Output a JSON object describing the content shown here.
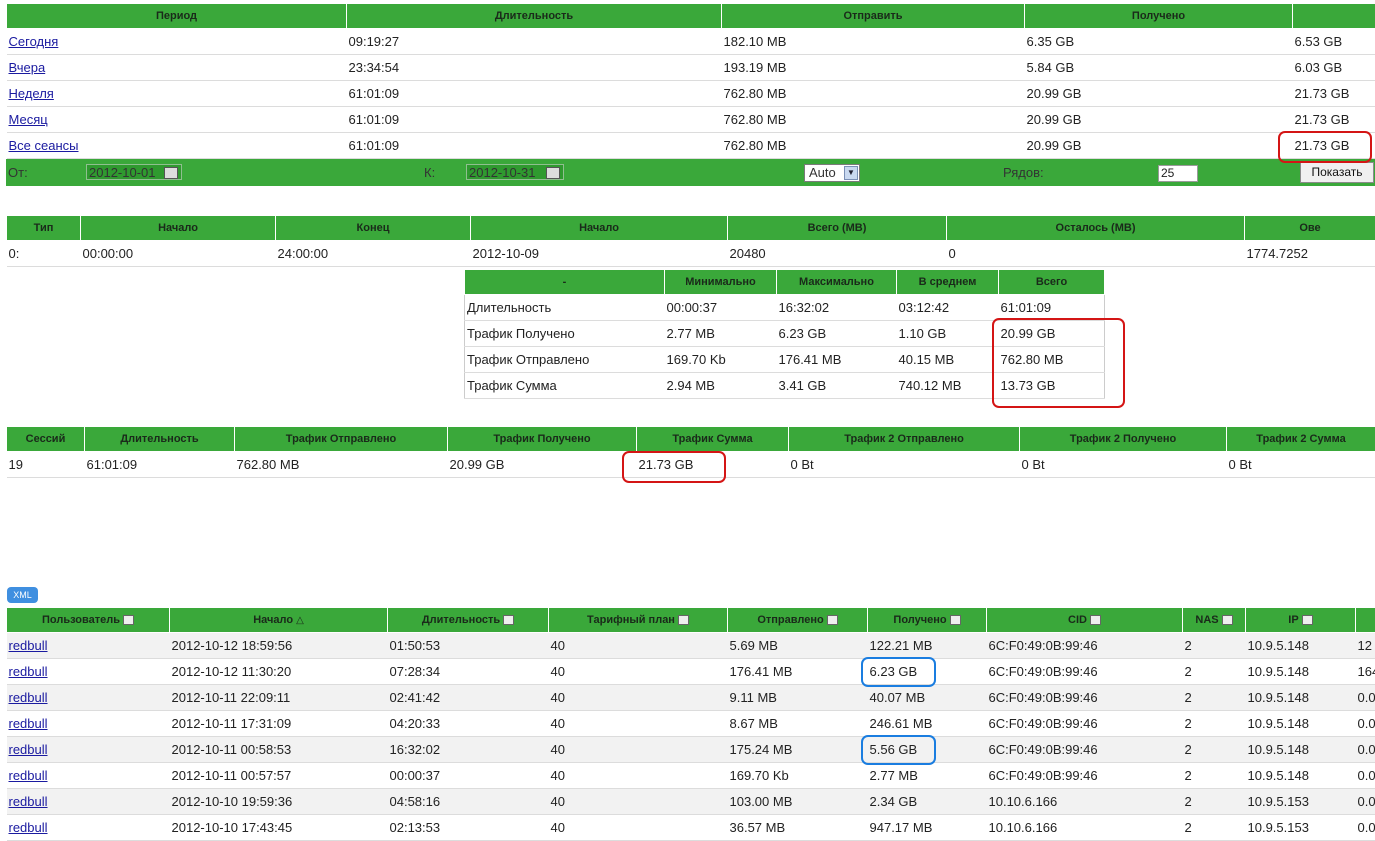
{
  "period_table": {
    "headers": [
      "Период",
      "Длительность",
      "Отправить",
      "Получено",
      ""
    ],
    "rows": [
      [
        "Сегодня",
        "09:19:27",
        "182.10 MB",
        "6.35 GB",
        "6.53 GB"
      ],
      [
        "Вчера",
        "23:34:54",
        "193.19 MB",
        "5.84 GB",
        "6.03 GB"
      ],
      [
        "Неделя",
        "61:01:09",
        "762.80 MB",
        "20.99 GB",
        "21.73 GB"
      ],
      [
        "Месяц",
        "61:01:09",
        "762.80 MB",
        "20.99 GB",
        "21.73 GB"
      ],
      [
        "Все сеансы",
        "61:01:09",
        "762.80 MB",
        "20.99 GB",
        "21.73 GB"
      ]
    ]
  },
  "filter": {
    "from_label": "От:",
    "from_value": "2012-10-01",
    "to_label": "К:",
    "to_value": "2012-10-31",
    "mode_value": "Auto",
    "rows_label": "Рядов:",
    "rows_value": "25",
    "show_button": "Показать"
  },
  "tariff_table": {
    "headers": [
      "Тип",
      "Начало",
      "Конец",
      "Начало",
      "Всего (MB)",
      "Осталось (MB)",
      "Ове"
    ],
    "row": [
      "0:",
      "00:00:00",
      "24:00:00",
      "2012-10-09",
      "20480",
      "0",
      "1774.7252"
    ]
  },
  "stats_table": {
    "headers": [
      "-",
      "Минимально",
      "Максимально",
      "В среднем",
      "Всего"
    ],
    "rows": [
      [
        "Длительность",
        "00:00:37",
        "16:32:02",
        "03:12:42",
        "61:01:09"
      ],
      [
        "Трафик Получено",
        "2.77 MB",
        "6.23 GB",
        "1.10 GB",
        "20.99 GB"
      ],
      [
        "Трафик Отправлено",
        "169.70 Kb",
        "176.41 MB",
        "40.15 MB",
        "762.80 MB"
      ],
      [
        "Трафик Сумма",
        "2.94 MB",
        "3.41 GB",
        "740.12 MB",
        "13.73 GB"
      ]
    ]
  },
  "totals_table": {
    "headers": [
      "Сессий",
      "Длительность",
      "Трафик Отправлено",
      "Трафик Получено",
      "Трафик Сумма",
      "Трафик 2 Отправлено",
      "Трафик 2 Получено",
      "Трафик 2 Сумма"
    ],
    "row": [
      "19",
      "61:01:09",
      "762.80 MB",
      "20.99 GB",
      "21.73 GB",
      "0 Bt",
      "0 Bt",
      "0 Bt"
    ]
  },
  "xml_button": "XML",
  "sessions_table": {
    "headers": [
      "Пользователь",
      "Начало",
      "Длительность",
      "Тарифный план",
      "Отправлено",
      "Получено",
      "CID",
      "NAS",
      "IP",
      ""
    ],
    "rows": [
      [
        "redbull",
        "2012-10-12 18:59:56",
        "01:50:53",
        "40",
        "5.69 MB",
        "122.21 MB",
        "6C:F0:49:0B:99:46",
        "2",
        "10.9.5.148",
        "12"
      ],
      [
        "redbull",
        "2012-10-12 11:30:20",
        "07:28:34",
        "40",
        "176.41 MB",
        "6.23 GB",
        "6C:F0:49:0B:99:46",
        "2",
        "10.9.5.148",
        "164"
      ],
      [
        "redbull",
        "2012-10-11 22:09:11",
        "02:41:42",
        "40",
        "9.11 MB",
        "40.07 MB",
        "6C:F0:49:0B:99:46",
        "2",
        "10.9.5.148",
        "0.0"
      ],
      [
        "redbull",
        "2012-10-11 17:31:09",
        "04:20:33",
        "40",
        "8.67 MB",
        "246.61 MB",
        "6C:F0:49:0B:99:46",
        "2",
        "10.9.5.148",
        "0.0"
      ],
      [
        "redbull",
        "2012-10-11 00:58:53",
        "16:32:02",
        "40",
        "175.24 MB",
        "5.56 GB",
        "6C:F0:49:0B:99:46",
        "2",
        "10.9.5.148",
        "0.0"
      ],
      [
        "redbull",
        "2012-10-11 00:57:57",
        "00:00:37",
        "40",
        "169.70 Kb",
        "2.77 MB",
        "6C:F0:49:0B:99:46",
        "2",
        "10.9.5.148",
        "0.0"
      ],
      [
        "redbull",
        "2012-10-10 19:59:36",
        "04:58:16",
        "40",
        "103.00 MB",
        "2.34 GB",
        "10.10.6.166",
        "2",
        "10.9.5.153",
        "0.0"
      ],
      [
        "redbull",
        "2012-10-10 17:43:45",
        "02:13:53",
        "40",
        "36.57 MB",
        "947.17 MB",
        "10.10.6.166",
        "2",
        "10.9.5.153",
        "0.0"
      ]
    ]
  },
  "colors": {
    "header_green": "#3aa83a",
    "highlight_red": "#d41515",
    "highlight_blue": "#1a7de0"
  }
}
